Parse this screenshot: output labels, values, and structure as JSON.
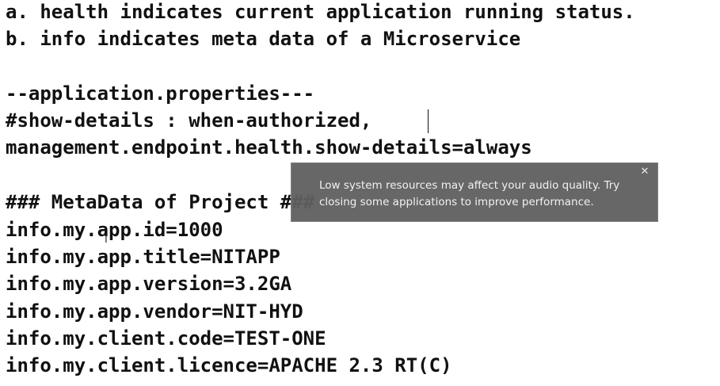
{
  "editor": {
    "lines": [
      "a. health indicates current application running status.",
      "b. info indicates meta data of a Microservice",
      "",
      "--application.properties---",
      "#show-details : when-authorized,",
      "management.endpoint.health.show-details=always",
      "",
      "### MetaData of Project ###",
      "info.my.app.id=1000",
      "info.my.app.title=NITAPP",
      "info.my.app.version=3.2GA",
      "info.my.app.vendor=NIT-HYD",
      "info.my.client.code=TEST-ONE",
      "info.my.client.licence=APACHE 2.3 RT(C)"
    ]
  },
  "notification": {
    "message": "Low system resources may affect your audio quality. Try closing some applications to improve performance.",
    "close_label": "✕",
    "close_icon": "close-icon"
  }
}
